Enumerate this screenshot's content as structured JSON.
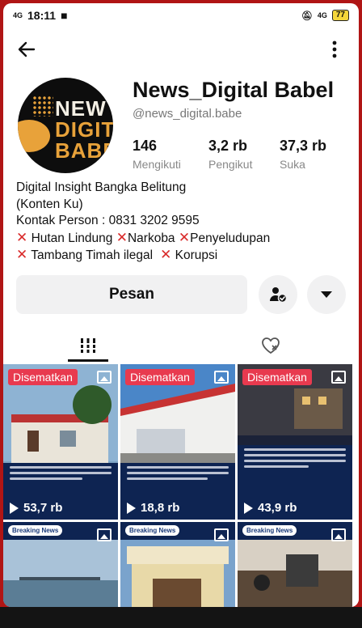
{
  "status_bar": {
    "time": "18:11",
    "left_signal": "4G",
    "right_signal": "4G",
    "battery": "77"
  },
  "profile": {
    "avatar_logo": [
      "NEW",
      "DIGIT",
      "BABE"
    ],
    "username": "News_Digital Babel",
    "handle": "@news_digital.babe",
    "stats": [
      {
        "value": "146",
        "label": "Mengikuti"
      },
      {
        "value": "3,2 rb",
        "label": "Pengikut"
      },
      {
        "value": "37,3 rb",
        "label": "Suka"
      }
    ],
    "bio": {
      "line1": "Digital Insight Bangka Belitung",
      "line2": "(Konten Ku)",
      "line3": "Kontak Person : 0831 3202 9595",
      "tags_row1": [
        "Hutan Lindung",
        "Narkoba",
        "Penyeludupan"
      ],
      "tags_row2": [
        "Tambang Timah ilegal",
        "Korupsi"
      ]
    }
  },
  "actions": {
    "message_label": "Pesan"
  },
  "grid": {
    "pinned_label": "Disematkan",
    "breaking_label": "Breaking News",
    "posts": [
      {
        "views": "53,7 rb"
      },
      {
        "views": "18,8 rb"
      },
      {
        "views": "43,9 rb"
      }
    ]
  },
  "colors": {
    "accent_red": "#e83a4f",
    "tag_x_red": "#d92b2b",
    "frame_red": "#b01515",
    "navy": "#0e2452"
  }
}
